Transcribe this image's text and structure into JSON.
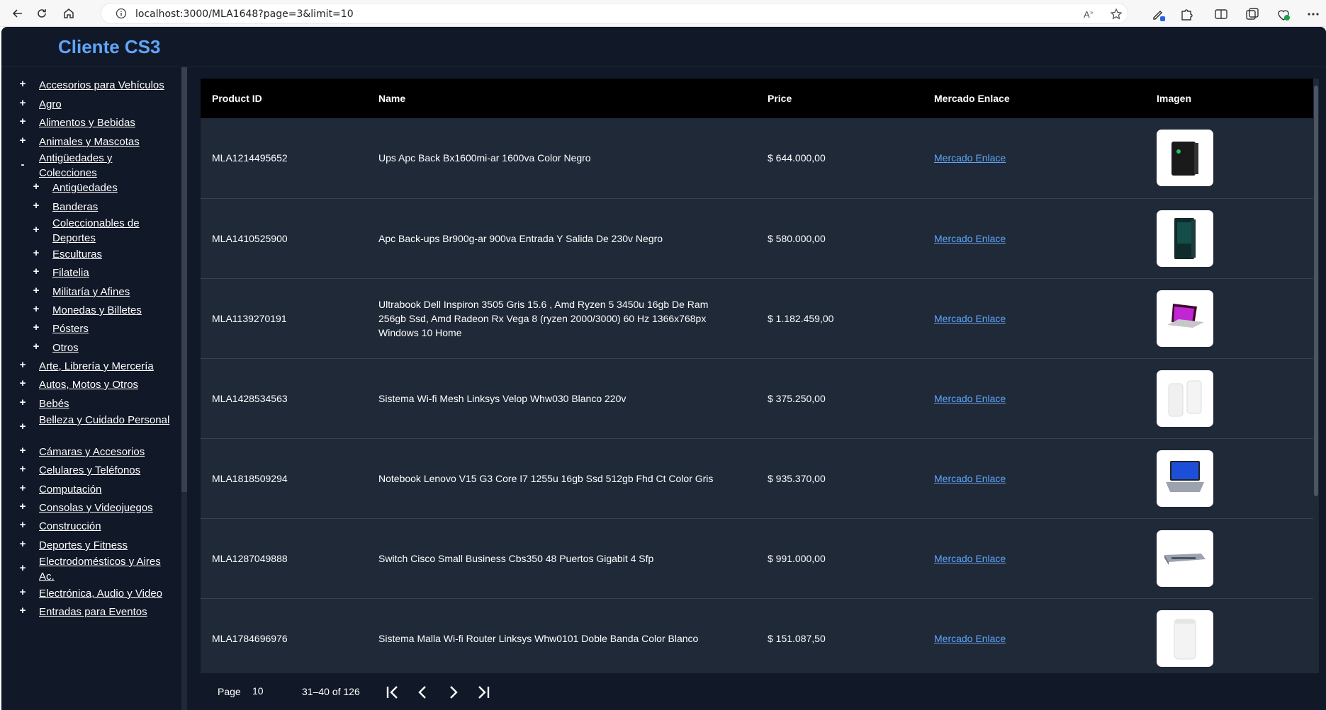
{
  "browser": {
    "url": "localhost:3000/MLA1648?page=3&limit=10"
  },
  "app": {
    "title": "Cliente CS3"
  },
  "sidebar": {
    "items": [
      {
        "sign": "+",
        "label": "Accesorios para Vehículos"
      },
      {
        "sign": "+",
        "label": "Agro"
      },
      {
        "sign": "+",
        "label": "Alimentos y Bebidas"
      },
      {
        "sign": "+",
        "label": "Animales y Mascotas"
      },
      {
        "sign": "-",
        "label": "Antigüedades y Colecciones"
      },
      {
        "sign": "+",
        "label": "Antigüedades"
      },
      {
        "sign": "+",
        "label": "Banderas"
      },
      {
        "sign": "+",
        "label": "Coleccionables de Deportes"
      },
      {
        "sign": "+",
        "label": "Esculturas"
      },
      {
        "sign": "+",
        "label": "Filatelia"
      },
      {
        "sign": "+",
        "label": "Militaría y Afines"
      },
      {
        "sign": "+",
        "label": "Monedas y Billetes"
      },
      {
        "sign": "+",
        "label": "Pósters"
      },
      {
        "sign": "+",
        "label": "Otros"
      },
      {
        "sign": "+",
        "label": "Arte, Librería y Mercería"
      },
      {
        "sign": "+",
        "label": "Autos, Motos y Otros"
      },
      {
        "sign": "+",
        "label": "Bebés"
      },
      {
        "sign": "+",
        "label": "Belleza y Cuidado Personal"
      },
      {
        "sign": "+",
        "label": "Cámaras y Accesorios"
      },
      {
        "sign": "+",
        "label": "Celulares y Teléfonos"
      },
      {
        "sign": "+",
        "label": "Computación"
      },
      {
        "sign": "+",
        "label": "Consolas y Videojuegos"
      },
      {
        "sign": "+",
        "label": "Construcción"
      },
      {
        "sign": "+",
        "label": "Deportes y Fitness"
      },
      {
        "sign": "+",
        "label": "Electrodomésticos y Aires Ac."
      },
      {
        "sign": "+",
        "label": "Electrónica, Audio y Video"
      },
      {
        "sign": "+",
        "label": "Entradas para Eventos"
      }
    ]
  },
  "table": {
    "headers": [
      "Product ID",
      "Name",
      "Price",
      "Mercado Enlace",
      "Imagen"
    ],
    "rows": [
      {
        "id": "MLA1214495652",
        "name": "Ups Apc Back Bx1600mi-ar 1600va Color Negro",
        "price": "$ 644.000,00",
        "link": "Mercado Enlace",
        "img": "ups-black"
      },
      {
        "id": "MLA1410525900",
        "name": "Apc Back-ups Br900g-ar 900va Entrada Y Salida De 230v Negro",
        "price": "$ 580.000,00",
        "link": "Mercado Enlace",
        "img": "ups-tower"
      },
      {
        "id": "MLA1139270191",
        "name": "Ultrabook Dell Inspiron 3505 Gris 15.6 , Amd Ryzen 5 3450u 16gb De Ram 256gb Ssd, Amd Radeon Rx Vega 8 (ryzen 2000/3000) 60 Hz 1366x768px Windows 10 Home",
        "price": "$ 1.182.459,00",
        "link": "Mercado Enlace",
        "img": "laptop-pink"
      },
      {
        "id": "MLA1428534563",
        "name": "Sistema Wi-fi Mesh Linksys Velop Whw030 Blanco 220v",
        "price": "$ 375.250,00",
        "link": "Mercado Enlace",
        "img": "mesh-white"
      },
      {
        "id": "MLA1818509294",
        "name": "Notebook Lenovo V15 G3 Core I7 1255u 16gb Ssd 512gb Fhd Ct Color Gris",
        "price": "$ 935.370,00",
        "link": "Mercado Enlace",
        "img": "laptop-blue"
      },
      {
        "id": "MLA1287049888",
        "name": "Switch Cisco Small Business Cbs350 48 Puertos Gigabit 4 Sfp",
        "price": "$ 991.000,00",
        "link": "Mercado Enlace",
        "img": "switch"
      },
      {
        "id": "MLA1784696976",
        "name": "Sistema Malla Wi-fi Router Linksys Whw0101 Doble Banda Color Blanco",
        "price": "$ 151.087,50",
        "link": "Mercado Enlace",
        "img": "router-white"
      }
    ]
  },
  "pager": {
    "label": "Page",
    "page": "10",
    "range": "31–40 of 126"
  }
}
